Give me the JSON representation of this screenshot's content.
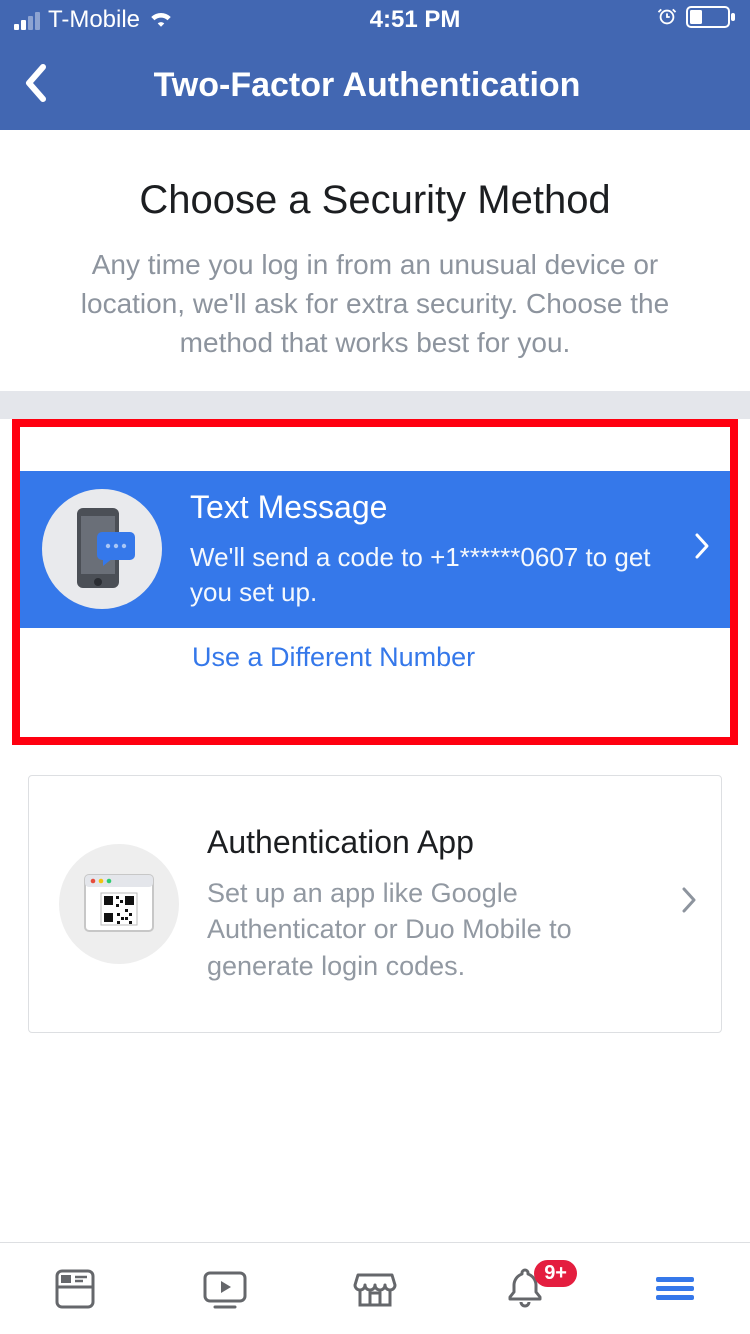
{
  "status_bar": {
    "carrier": "T-Mobile",
    "time": "4:51 PM"
  },
  "nav": {
    "title": "Two-Factor Authentication"
  },
  "header": {
    "title": "Choose a Security Method",
    "subtitle": "Any time you log in from an unusual device or location, we'll ask for extra security. Choose the method that works best for you."
  },
  "options": {
    "text_message": {
      "title": "Text Message",
      "desc": "We'll send a code to +1******0607 to get you set up.",
      "alt_link": "Use a Different Number"
    },
    "auth_app": {
      "title": "Authentication App",
      "desc": "Set up an app like Google Authenticator or Duo Mobile to generate login codes."
    }
  },
  "tabbar": {
    "badge": "9+"
  }
}
